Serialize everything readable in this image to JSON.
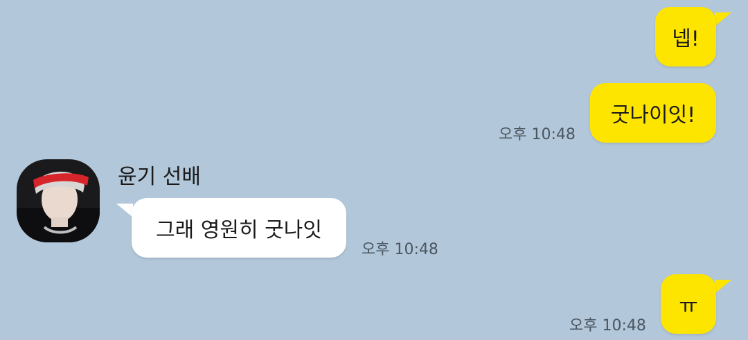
{
  "messages": [
    {
      "id": "m1",
      "side": "mine",
      "text": "넵!",
      "time": ""
    },
    {
      "id": "m2",
      "side": "mine",
      "text": "굿나이잇!",
      "time": "오후 10:48"
    },
    {
      "id": "m3",
      "side": "theirs",
      "text": "그래 영원히 굿나잇",
      "time": "오후 10:48"
    },
    {
      "id": "m4",
      "side": "mine",
      "text": "ㅠ",
      "time": "오후 10:48"
    }
  ],
  "sender": {
    "name": "윤기 선배",
    "avatar": "profile-photo"
  },
  "colors": {
    "background": "#b2c7da",
    "my_bubble": "#fee500",
    "their_bubble": "#ffffff"
  }
}
